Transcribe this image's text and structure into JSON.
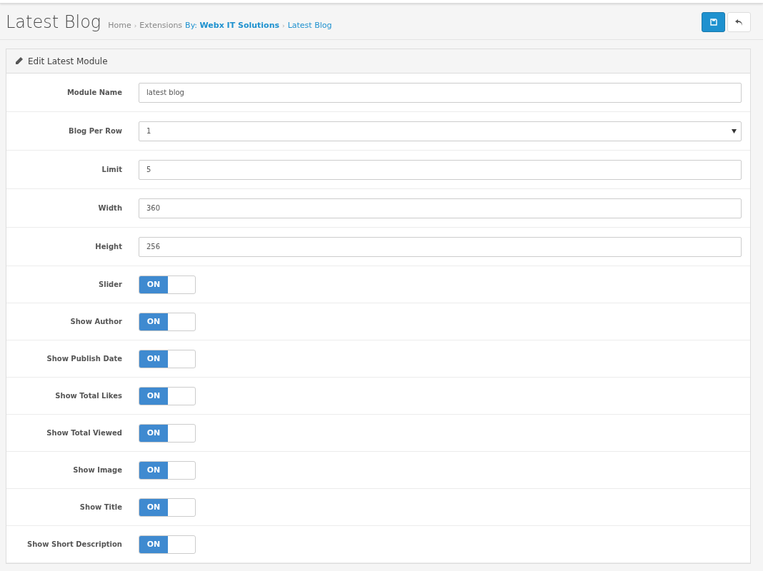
{
  "header": {
    "title": "Latest Blog",
    "breadcrumb": [
      {
        "label": "Home",
        "kind": "plain"
      },
      {
        "label": "Extensions",
        "kind": "plain",
        "separator": "›"
      },
      {
        "label": "By: **Webx IT Solutions**",
        "kind": "link"
      },
      {
        "label": "Latest Blog",
        "kind": "link",
        "separator": "›"
      }
    ]
  },
  "panel": {
    "title": "Edit Latest Module",
    "fields": [
      {
        "kind": "text",
        "label": "Module Name",
        "value": "latest blog"
      },
      {
        "kind": "select",
        "label": "Blog Per Row",
        "value": "1"
      },
      {
        "kind": "text",
        "label": "Limit",
        "value": "5"
      },
      {
        "kind": "text",
        "label": "Width",
        "value": "360"
      },
      {
        "kind": "text",
        "label": "Height",
        "value": "256"
      },
      {
        "kind": "toggle",
        "label": "Slider",
        "on": true,
        "text": "ON"
      },
      {
        "kind": "toggle",
        "label": "Show Author",
        "on": true,
        "text": "ON"
      },
      {
        "kind": "toggle",
        "label": "Show Publish Date",
        "on": true,
        "text": "ON"
      },
      {
        "kind": "toggle",
        "label": "Show Total Likes",
        "on": true,
        "text": "ON"
      },
      {
        "kind": "toggle",
        "label": "Show Total Viewed",
        "on": true,
        "text": "ON"
      },
      {
        "kind": "toggle",
        "label": "Show Image",
        "on": true,
        "text": "ON"
      },
      {
        "kind": "toggle",
        "label": "Show Title",
        "on": true,
        "text": "ON"
      },
      {
        "kind": "toggle",
        "label": "Show Short Description",
        "on": true,
        "text": "ON"
      }
    ]
  }
}
